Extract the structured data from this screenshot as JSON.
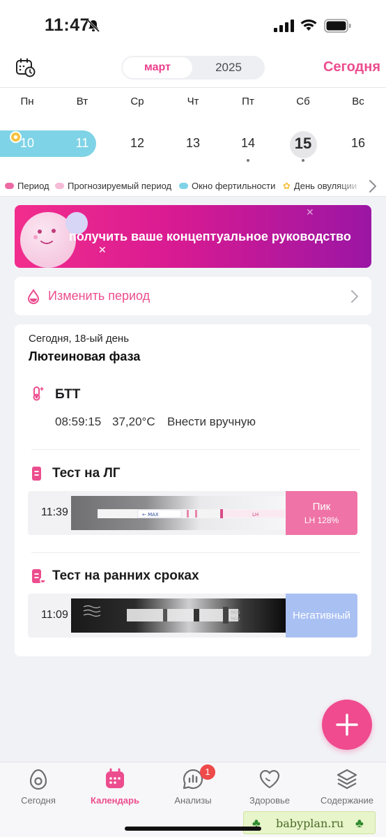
{
  "status_bar": {
    "time": "11:47"
  },
  "header": {
    "month": "март",
    "year": "2025",
    "today_label": "Сегодня"
  },
  "week": {
    "weekdays": [
      "Пн",
      "Вт",
      "Ср",
      "Чт",
      "Пт",
      "Сб",
      "Вс"
    ],
    "days": [
      "10",
      "11",
      "12",
      "13",
      "14",
      "15",
      "16"
    ],
    "today_index": 5
  },
  "legend": {
    "items": [
      {
        "label": "Период",
        "color": "#ec6aa3"
      },
      {
        "label": "Прогнозируемый период",
        "color": "#f5bbd7"
      },
      {
        "label": "Окно фертильности",
        "color": "#7fd3e6"
      },
      {
        "label": "День овуляции",
        "color": "#f5c242"
      }
    ]
  },
  "promo": {
    "text": "получить ваше концептуальное руководство"
  },
  "edit_period": {
    "label": "Изменить период"
  },
  "day_card": {
    "subtitle": "Сегодня, 18-ый день",
    "phase": "Лютеиновая фаза",
    "bbt": {
      "title": "БТТ",
      "time": "08:59:15",
      "temperature": "37,20°C",
      "manual_label": "Внести вручную"
    },
    "lh_test": {
      "title": "Тест на ЛГ",
      "time": "11:39",
      "result": "Пик",
      "detail": "LH 128%",
      "strip_marks": [
        "← MAX",
        "LH"
      ]
    },
    "early_test": {
      "title": "Тест на ранних сроках",
      "time": "11:09",
      "result": "Негативный",
      "strip_marks": [
        "hCG",
        "hCG"
      ]
    }
  },
  "bottom_nav": {
    "items": [
      {
        "label": "Сегодня"
      },
      {
        "label": "Календарь"
      },
      {
        "label": "Анализы",
        "badge": "1"
      },
      {
        "label": "Здоровье"
      },
      {
        "label": "Содержание"
      }
    ],
    "active_index": 1
  },
  "watermark": {
    "text": "babyplan.ru"
  },
  "colors": {
    "accent": "#ec4d8e",
    "fertile": "#7fd3e6",
    "lh_peak": "#ef73a6",
    "negative": "#a9c0f3"
  }
}
